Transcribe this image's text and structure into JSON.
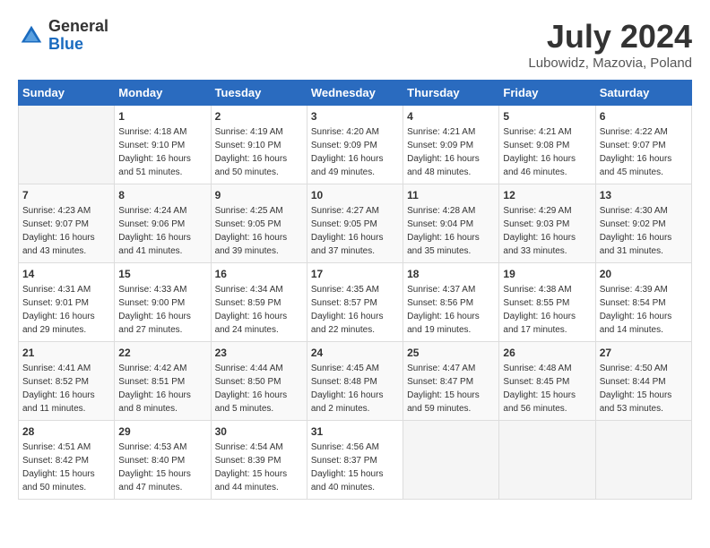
{
  "header": {
    "logo_general": "General",
    "logo_blue": "Blue",
    "month_year": "July 2024",
    "location": "Lubowidz, Mazovia, Poland"
  },
  "days_of_week": [
    "Sunday",
    "Monday",
    "Tuesday",
    "Wednesday",
    "Thursday",
    "Friday",
    "Saturday"
  ],
  "weeks": [
    [
      {
        "day": "",
        "sunrise": "",
        "sunset": "",
        "daylight": ""
      },
      {
        "day": "1",
        "sunrise": "Sunrise: 4:18 AM",
        "sunset": "Sunset: 9:10 PM",
        "daylight": "Daylight: 16 hours and 51 minutes."
      },
      {
        "day": "2",
        "sunrise": "Sunrise: 4:19 AM",
        "sunset": "Sunset: 9:10 PM",
        "daylight": "Daylight: 16 hours and 50 minutes."
      },
      {
        "day": "3",
        "sunrise": "Sunrise: 4:20 AM",
        "sunset": "Sunset: 9:09 PM",
        "daylight": "Daylight: 16 hours and 49 minutes."
      },
      {
        "day": "4",
        "sunrise": "Sunrise: 4:21 AM",
        "sunset": "Sunset: 9:09 PM",
        "daylight": "Daylight: 16 hours and 48 minutes."
      },
      {
        "day": "5",
        "sunrise": "Sunrise: 4:21 AM",
        "sunset": "Sunset: 9:08 PM",
        "daylight": "Daylight: 16 hours and 46 minutes."
      },
      {
        "day": "6",
        "sunrise": "Sunrise: 4:22 AM",
        "sunset": "Sunset: 9:07 PM",
        "daylight": "Daylight: 16 hours and 45 minutes."
      }
    ],
    [
      {
        "day": "7",
        "sunrise": "Sunrise: 4:23 AM",
        "sunset": "Sunset: 9:07 PM",
        "daylight": "Daylight: 16 hours and 43 minutes."
      },
      {
        "day": "8",
        "sunrise": "Sunrise: 4:24 AM",
        "sunset": "Sunset: 9:06 PM",
        "daylight": "Daylight: 16 hours and 41 minutes."
      },
      {
        "day": "9",
        "sunrise": "Sunrise: 4:25 AM",
        "sunset": "Sunset: 9:05 PM",
        "daylight": "Daylight: 16 hours and 39 minutes."
      },
      {
        "day": "10",
        "sunrise": "Sunrise: 4:27 AM",
        "sunset": "Sunset: 9:05 PM",
        "daylight": "Daylight: 16 hours and 37 minutes."
      },
      {
        "day": "11",
        "sunrise": "Sunrise: 4:28 AM",
        "sunset": "Sunset: 9:04 PM",
        "daylight": "Daylight: 16 hours and 35 minutes."
      },
      {
        "day": "12",
        "sunrise": "Sunrise: 4:29 AM",
        "sunset": "Sunset: 9:03 PM",
        "daylight": "Daylight: 16 hours and 33 minutes."
      },
      {
        "day": "13",
        "sunrise": "Sunrise: 4:30 AM",
        "sunset": "Sunset: 9:02 PM",
        "daylight": "Daylight: 16 hours and 31 minutes."
      }
    ],
    [
      {
        "day": "14",
        "sunrise": "Sunrise: 4:31 AM",
        "sunset": "Sunset: 9:01 PM",
        "daylight": "Daylight: 16 hours and 29 minutes."
      },
      {
        "day": "15",
        "sunrise": "Sunrise: 4:33 AM",
        "sunset": "Sunset: 9:00 PM",
        "daylight": "Daylight: 16 hours and 27 minutes."
      },
      {
        "day": "16",
        "sunrise": "Sunrise: 4:34 AM",
        "sunset": "Sunset: 8:59 PM",
        "daylight": "Daylight: 16 hours and 24 minutes."
      },
      {
        "day": "17",
        "sunrise": "Sunrise: 4:35 AM",
        "sunset": "Sunset: 8:57 PM",
        "daylight": "Daylight: 16 hours and 22 minutes."
      },
      {
        "day": "18",
        "sunrise": "Sunrise: 4:37 AM",
        "sunset": "Sunset: 8:56 PM",
        "daylight": "Daylight: 16 hours and 19 minutes."
      },
      {
        "day": "19",
        "sunrise": "Sunrise: 4:38 AM",
        "sunset": "Sunset: 8:55 PM",
        "daylight": "Daylight: 16 hours and 17 minutes."
      },
      {
        "day": "20",
        "sunrise": "Sunrise: 4:39 AM",
        "sunset": "Sunset: 8:54 PM",
        "daylight": "Daylight: 16 hours and 14 minutes."
      }
    ],
    [
      {
        "day": "21",
        "sunrise": "Sunrise: 4:41 AM",
        "sunset": "Sunset: 8:52 PM",
        "daylight": "Daylight: 16 hours and 11 minutes."
      },
      {
        "day": "22",
        "sunrise": "Sunrise: 4:42 AM",
        "sunset": "Sunset: 8:51 PM",
        "daylight": "Daylight: 16 hours and 8 minutes."
      },
      {
        "day": "23",
        "sunrise": "Sunrise: 4:44 AM",
        "sunset": "Sunset: 8:50 PM",
        "daylight": "Daylight: 16 hours and 5 minutes."
      },
      {
        "day": "24",
        "sunrise": "Sunrise: 4:45 AM",
        "sunset": "Sunset: 8:48 PM",
        "daylight": "Daylight: 16 hours and 2 minutes."
      },
      {
        "day": "25",
        "sunrise": "Sunrise: 4:47 AM",
        "sunset": "Sunset: 8:47 PM",
        "daylight": "Daylight: 15 hours and 59 minutes."
      },
      {
        "day": "26",
        "sunrise": "Sunrise: 4:48 AM",
        "sunset": "Sunset: 8:45 PM",
        "daylight": "Daylight: 15 hours and 56 minutes."
      },
      {
        "day": "27",
        "sunrise": "Sunrise: 4:50 AM",
        "sunset": "Sunset: 8:44 PM",
        "daylight": "Daylight: 15 hours and 53 minutes."
      }
    ],
    [
      {
        "day": "28",
        "sunrise": "Sunrise: 4:51 AM",
        "sunset": "Sunset: 8:42 PM",
        "daylight": "Daylight: 15 hours and 50 minutes."
      },
      {
        "day": "29",
        "sunrise": "Sunrise: 4:53 AM",
        "sunset": "Sunset: 8:40 PM",
        "daylight": "Daylight: 15 hours and 47 minutes."
      },
      {
        "day": "30",
        "sunrise": "Sunrise: 4:54 AM",
        "sunset": "Sunset: 8:39 PM",
        "daylight": "Daylight: 15 hours and 44 minutes."
      },
      {
        "day": "31",
        "sunrise": "Sunrise: 4:56 AM",
        "sunset": "Sunset: 8:37 PM",
        "daylight": "Daylight: 15 hours and 40 minutes."
      },
      {
        "day": "",
        "sunrise": "",
        "sunset": "",
        "daylight": ""
      },
      {
        "day": "",
        "sunrise": "",
        "sunset": "",
        "daylight": ""
      },
      {
        "day": "",
        "sunrise": "",
        "sunset": "",
        "daylight": ""
      }
    ]
  ]
}
